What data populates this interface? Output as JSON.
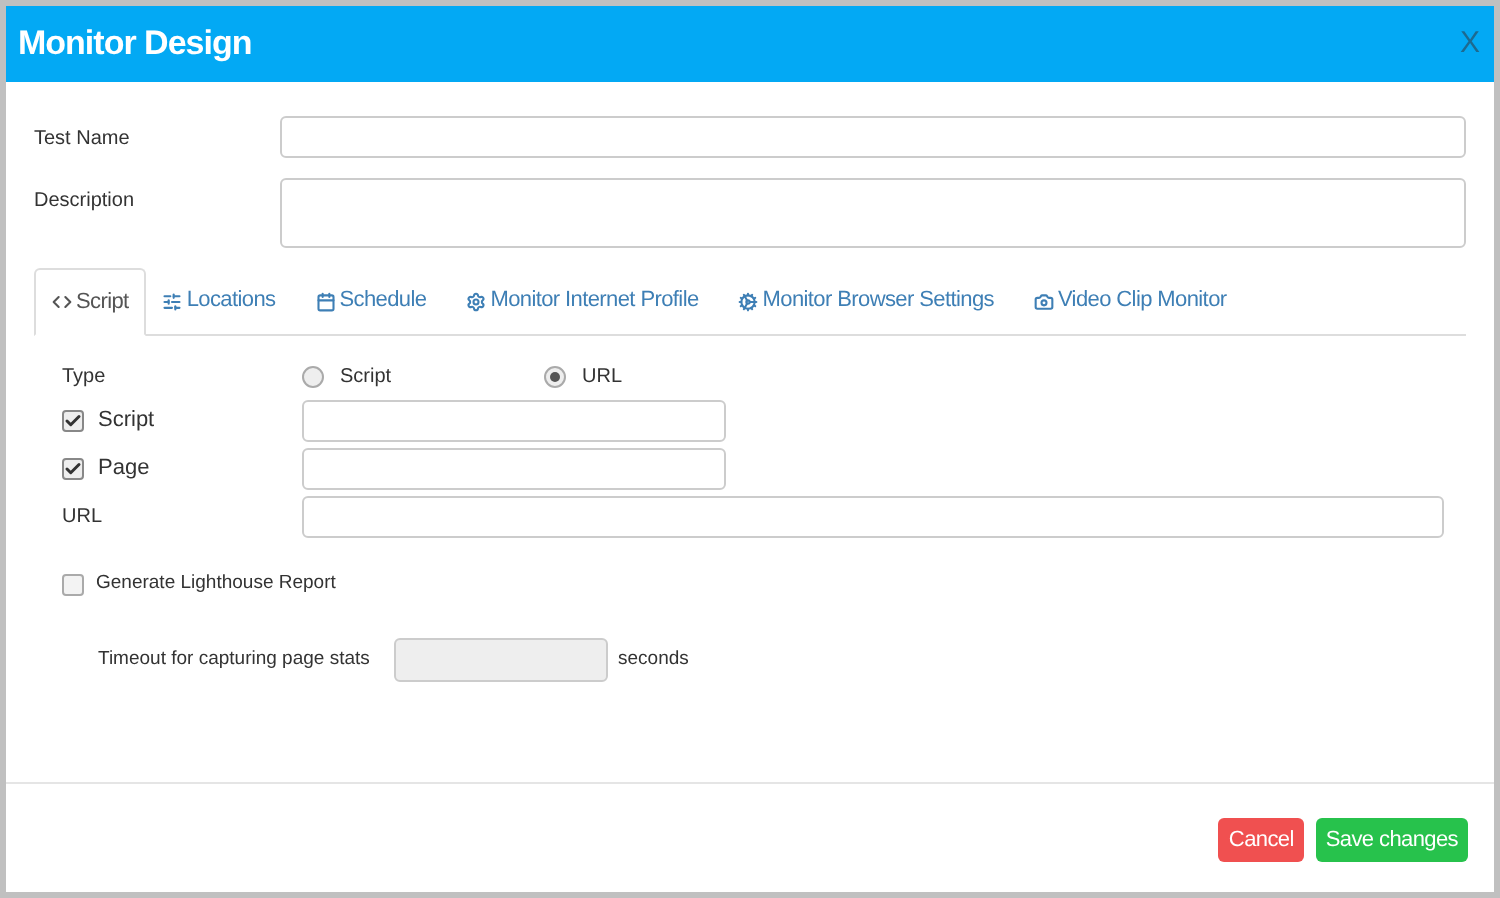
{
  "window": {
    "title": "Monitor Design",
    "close": "X"
  },
  "fields": [
    {
      "label": "Test Name",
      "kind": "input"
    },
    {
      "label": "Description",
      "kind": "textarea"
    }
  ],
  "tabs": [
    {
      "label": "Script",
      "selected": true
    },
    {
      "label": "Locations",
      "selected": false
    },
    {
      "label": "Schedule",
      "selected": false
    },
    {
      "label": "Monitor Internet Profile",
      "selected": false
    },
    {
      "label": "Monitor Browser Settings",
      "selected": false
    },
    {
      "label": "Video Clip Monitor",
      "selected": false
    }
  ],
  "type": {
    "label": "Type",
    "options": [
      {
        "label": "Script",
        "selected": false
      },
      {
        "label": "URL",
        "selected": true
      }
    ]
  },
  "url_fields": [
    {
      "label": "Script",
      "kind": "checkbox",
      "checked": true
    },
    {
      "label": "Page",
      "kind": "checkbox",
      "checked": true
    },
    {
      "label": "URL",
      "kind": "plain"
    }
  ],
  "lighthouse": {
    "label": "Generate Lighthouse Report",
    "checked": false
  },
  "timeout": {
    "label": "Timeout for capturing page stats",
    "unit": "seconds"
  },
  "buttons": [
    {
      "label": "Cancel",
      "kind": "danger"
    },
    {
      "label": "Save changes",
      "kind": "success"
    }
  ]
}
